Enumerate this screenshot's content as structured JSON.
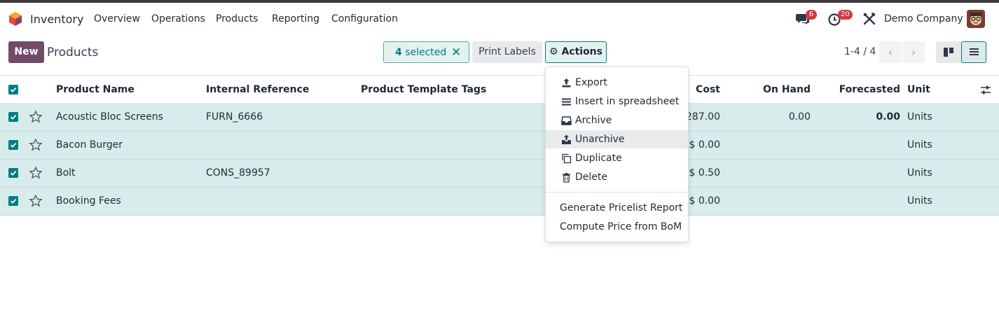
{
  "navbar": {
    "app_name": "Inventory",
    "menu": [
      "Overview",
      "Operations",
      "Products",
      "Reporting",
      "Configuration"
    ],
    "messages_badge": "6",
    "activities_badge": "20",
    "company": "Demo Company"
  },
  "control": {
    "new_label": "New",
    "title": "Products",
    "selected_count": "4",
    "selected_text": "selected",
    "print_labels": "Print Labels",
    "actions": "Actions",
    "pager": "1-4 / 4"
  },
  "table": {
    "headers": {
      "name": "Product Name",
      "ref": "Internal Reference",
      "tags": "Product Template Tags",
      "cost": "Cost",
      "onhand": "On Hand",
      "forecasted": "Forecasted",
      "unit": "Unit"
    },
    "rows": [
      {
        "name": "Acoustic Bloc Screens",
        "ref": "FURN_6666",
        "cost": "287.00",
        "onhand": "0.00",
        "forecasted": "0.00",
        "unit": "Units"
      },
      {
        "name": "Bacon Burger",
        "ref": "",
        "cost": "$ 0.00",
        "onhand": "",
        "forecasted": "",
        "unit": "Units"
      },
      {
        "name": "Bolt",
        "ref": "CONS_89957",
        "cost": "$ 0.50",
        "onhand": "",
        "forecasted": "",
        "unit": "Units"
      },
      {
        "name": "Booking Fees",
        "ref": "",
        "cost": "$ 0.00",
        "onhand": "",
        "forecasted": "",
        "unit": "Units"
      }
    ]
  },
  "actions_menu": {
    "items": [
      {
        "label": "Export",
        "icon": "upload-icon"
      },
      {
        "label": "Insert in spreadsheet",
        "icon": "list-icon"
      },
      {
        "label": "Archive",
        "icon": "inbox-icon"
      },
      {
        "label": "Unarchive",
        "icon": "unarchive-icon"
      },
      {
        "label": "Duplicate",
        "icon": "copy-icon"
      },
      {
        "label": "Delete",
        "icon": "trash-icon"
      }
    ],
    "extra": [
      "Generate Pricelist Report",
      "Compute Price from BoM"
    ]
  },
  "colors": {
    "brand": "#714b67",
    "accent": "#017e84",
    "selected_row": "#d8ecec",
    "badge": "#d9383f"
  }
}
